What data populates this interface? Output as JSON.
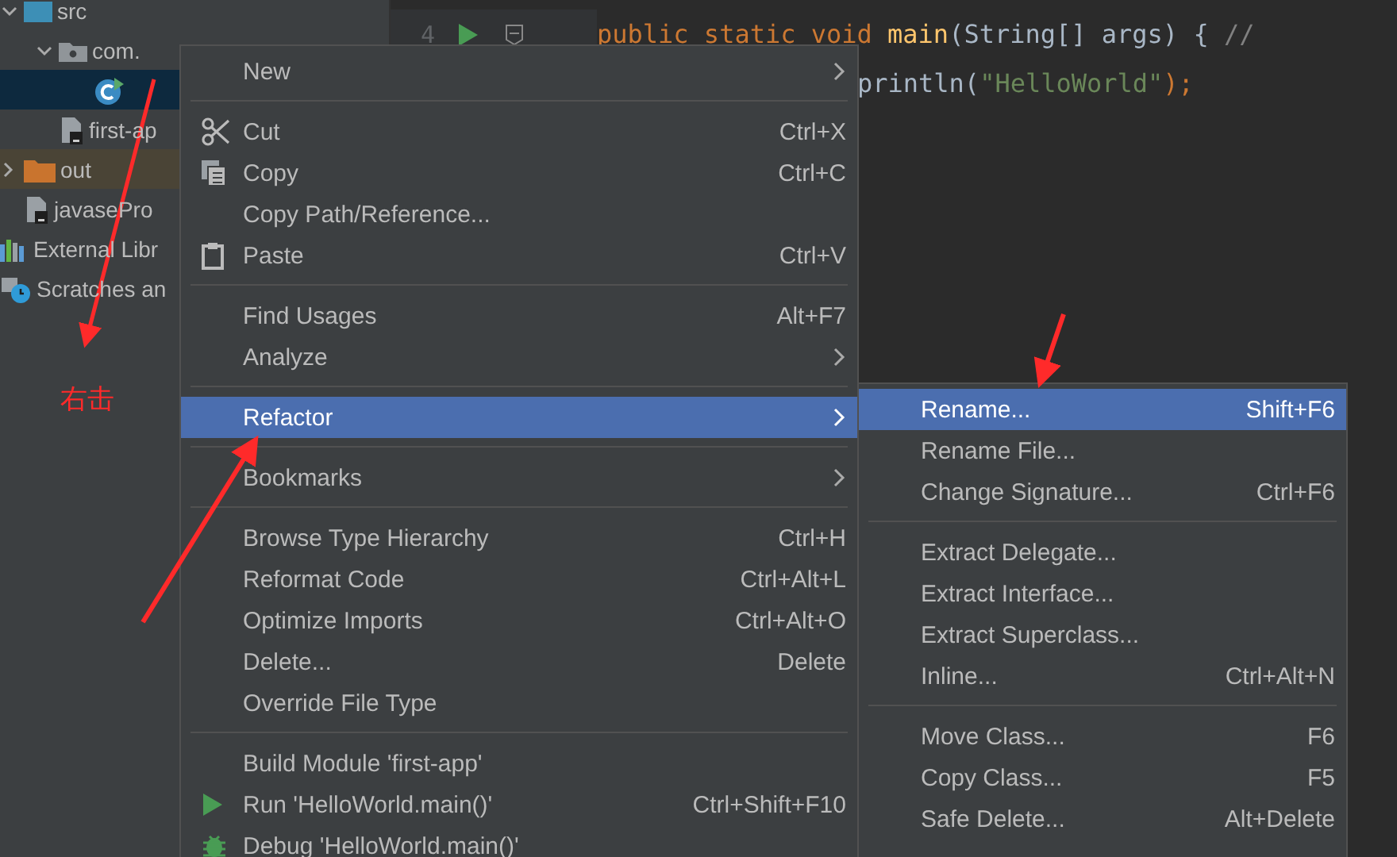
{
  "project_tree": [
    {
      "label": "src",
      "kind": "source-folder",
      "expanded": true,
      "selected": false,
      "children": [
        {
          "label": "com.",
          "kind": "package",
          "expanded": true,
          "selected": false,
          "children": [
            {
              "kind": "class",
              "selected": true
            }
          ]
        },
        {
          "label": "first-ap",
          "kind": "file",
          "selected": false
        }
      ]
    },
    {
      "label": "out",
      "kind": "excluded-folder",
      "expanded": false,
      "selected": false
    },
    {
      "label": "javasePro",
      "kind": "file",
      "selected": false
    },
    {
      "label": "External Libr",
      "kind": "libraries",
      "selected": false
    },
    {
      "label": "Scratches an",
      "kind": "scratches",
      "selected": false
    }
  ],
  "editor": {
    "lines": [
      {
        "number": "4",
        "run": true,
        "fold": true,
        "segments": [
          {
            "kind": "keyword",
            "text": "public static void "
          },
          {
            "kind": "method",
            "text": "main"
          },
          {
            "kind": "plain",
            "text": "(String[] args) { "
          },
          {
            "kind": "comment",
            "text": "//"
          }
        ]
      },
      {
        "run": false,
        "fold": false,
        "segments": [
          {
            "kind": "plain",
            "text": "println("
          },
          {
            "kind": "string",
            "text": "\"HelloWorld\""
          },
          {
            "kind": "keyword",
            "text": ");"
          }
        ]
      }
    ]
  },
  "annotation": "右击",
  "context_menu": [
    {
      "kind": "item",
      "label": "New",
      "submenu": true,
      "selected": false
    },
    {
      "kind": "separator"
    },
    {
      "kind": "cut",
      "label": "Cut",
      "shortcut": "Ctrl+X",
      "selected": false
    },
    {
      "kind": "copy",
      "label": "Copy",
      "shortcut": "Ctrl+C",
      "selected": false
    },
    {
      "kind": "item",
      "label": "Copy Path/Reference...",
      "selected": false
    },
    {
      "kind": "paste",
      "label": "Paste",
      "shortcut": "Ctrl+V",
      "selected": false
    },
    {
      "kind": "separator"
    },
    {
      "kind": "item",
      "label": "Find Usages",
      "shortcut": "Alt+F7",
      "selected": false
    },
    {
      "kind": "item",
      "label": "Analyze",
      "submenu": true,
      "selected": false
    },
    {
      "kind": "separator"
    },
    {
      "kind": "item",
      "label": "Refactor",
      "submenu": true,
      "selected": true
    },
    {
      "kind": "separator"
    },
    {
      "kind": "item",
      "label": "Bookmarks",
      "submenu": true,
      "selected": false
    },
    {
      "kind": "separator"
    },
    {
      "kind": "item",
      "label": "Browse Type Hierarchy",
      "shortcut": "Ctrl+H",
      "selected": false
    },
    {
      "kind": "item",
      "label": "Reformat Code",
      "shortcut": "Ctrl+Alt+L",
      "selected": false
    },
    {
      "kind": "item",
      "label": "Optimize Imports",
      "shortcut": "Ctrl+Alt+O",
      "selected": false
    },
    {
      "kind": "item",
      "label": "Delete...",
      "shortcut": "Delete",
      "selected": false
    },
    {
      "kind": "item",
      "label": "Override File Type",
      "selected": false
    },
    {
      "kind": "separator"
    },
    {
      "kind": "item",
      "label": "Build Module 'first-app'",
      "selected": false
    },
    {
      "kind": "run",
      "label": "Run 'HelloWorld.main()'",
      "shortcut": "Ctrl+Shift+F10",
      "selected": false
    },
    {
      "kind": "debug",
      "label": "Debug 'HelloWorld.main()'",
      "selected": false
    }
  ],
  "refactor_submenu": [
    {
      "kind": "item",
      "label": "Rename...",
      "shortcut": "Shift+F6",
      "selected": true
    },
    {
      "kind": "item",
      "label": "Rename File...",
      "selected": false
    },
    {
      "kind": "item",
      "label": "Change Signature...",
      "shortcut": "Ctrl+F6",
      "selected": false
    },
    {
      "kind": "separator"
    },
    {
      "kind": "item",
      "label": "Extract Delegate...",
      "selected": false
    },
    {
      "kind": "item",
      "label": "Extract Interface...",
      "selected": false
    },
    {
      "kind": "item",
      "label": "Extract Superclass...",
      "selected": false
    },
    {
      "kind": "item",
      "label": "Inline...",
      "shortcut": "Ctrl+Alt+N",
      "selected": false
    },
    {
      "kind": "separator"
    },
    {
      "kind": "item",
      "label": "Move Class...",
      "shortcut": "F6",
      "selected": false
    },
    {
      "kind": "item",
      "label": "Copy Class...",
      "shortcut": "F5",
      "selected": false
    },
    {
      "kind": "item",
      "label": "Safe Delete...",
      "shortcut": "Alt+Delete",
      "selected": false
    }
  ]
}
